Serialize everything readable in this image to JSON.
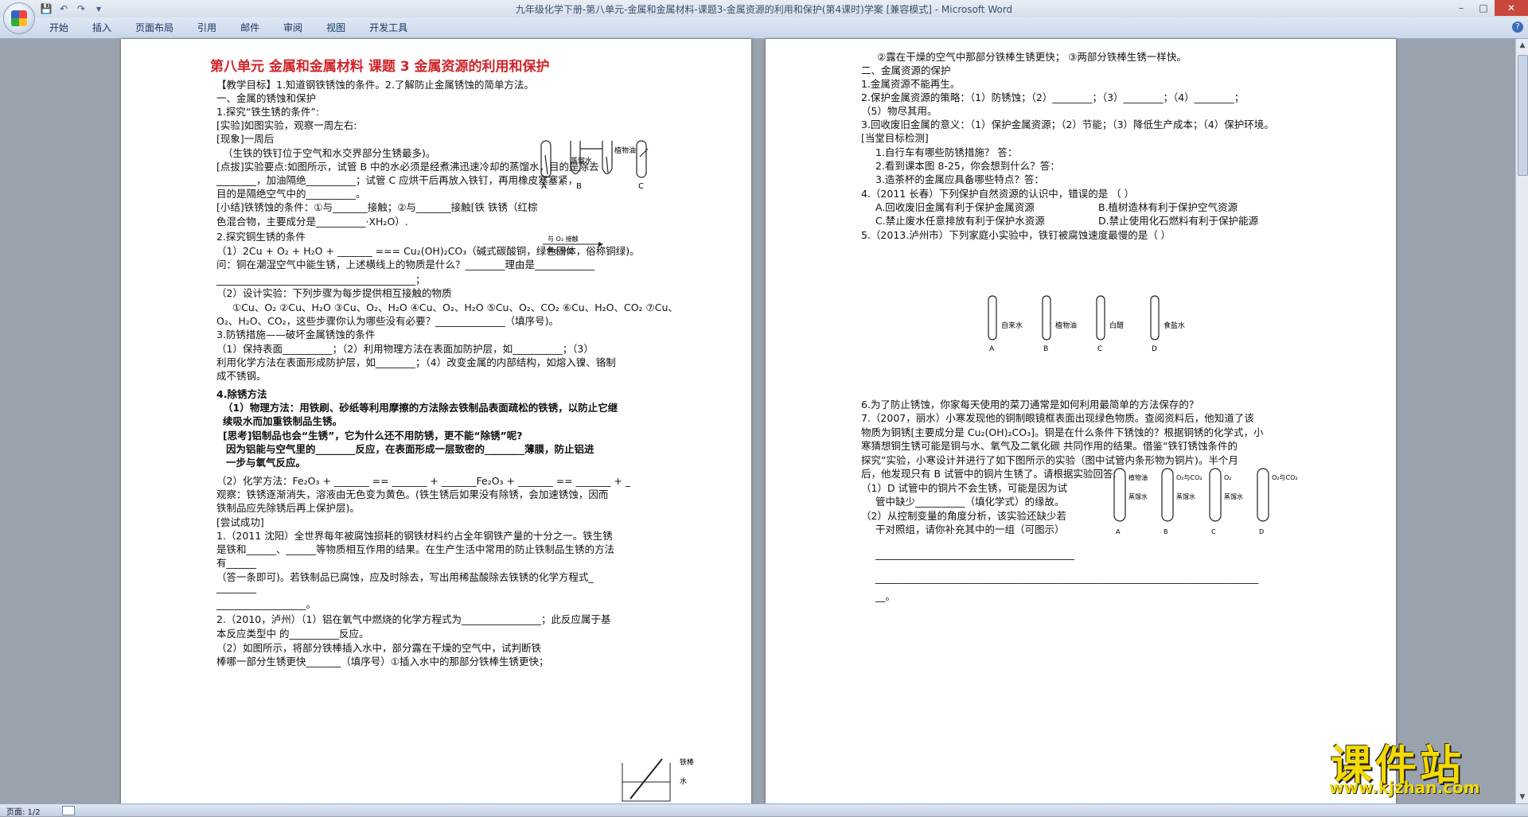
{
  "window": {
    "title": "九年级化学下册-第八单元-金属和金属材料-课题3-金属资源的利用和保护(第4课时)学案 [兼容模式] - Microsoft Word"
  },
  "ribbon": {
    "tabs": [
      "开始",
      "插入",
      "页面布局",
      "引用",
      "邮件",
      "审阅",
      "视图",
      "开发工具"
    ]
  },
  "status": {
    "page": "页面: 1/2"
  },
  "watermark": {
    "brand": "课件站",
    "url": "www.kjzhan.com"
  },
  "page1": {
    "title": "第八单元  金属和金属材料  课题 3  金属资源的利用和保护",
    "lines": [
      "【教学目标】1.知道钢铁锈蚀的条件。2.了解防止金属锈蚀的简单方法。",
      "一、金属的锈蚀和保护",
      "1.探究“铁生锈的条件”:",
      "[实验]如图实验，观察一周左右:",
      "[现象]一周后",
      "（生铁的铁钉位于空气和水交界部分生锈最多)。",
      "[点拔]实验要点:如图所示，试管 B 中的水必须是经煮沸迅速冷却的蒸馏水，目的是除去",
      "________，加油隔绝__________；试管 C 应烘干后再放入铁钉，再用橡皮塞塞紧，",
      "目的是隔绝空气中的__________。",
      "[小结]铁锈蚀的条件：①与_______接触；②与_______接触[铁            铁锈（红棕",
      "色混合物，主要成分是__________·XH₂O）.",
      "2.探究铜生锈的条件",
      "（1）2Cu + O₂ + H₂O + _______ === Cu₂(OH)₂CO₃（碱式碳酸铜，绿色固体，俗称铜绿)。",
      "问：铜在潮湿空气中能生锈，上述横线上的物质是什么？________理由是____________",
      "________________________________________；",
      "（2）设计实验：下列步骤为每步提供相互接触的物质",
      "①Cu、O₂ ②Cu、H₂O ③Cu、O₂、H₂O  ④Cu、O₂、H₂O  ⑤Cu、O₂、CO₂  ⑥Cu、H₂O、CO₂  ⑦Cu、",
      "O₂、H₂O、CO₂，这些步骤你认为哪些没有必要？______________（填序号)。",
      "3.防锈措施——破坏金属锈蚀的条件",
      "（1）保持表面__________；（2）利用物理方法在表面加防护层，如__________；（3）",
      "利用化学方法在表面形成防护层，如________；（4）改变金属的内部结构，如熔入镍、铬制",
      "成不锈钢。",
      "4.除锈方法",
      "（1）物理方法：用铁刷、砂纸等利用摩擦的方法除去铁制品表面疏松的铁锈，以防止它继",
      "续吸水而加重铁制品生锈。",
      "[思考]铝制品也会“生锈”，它为什么还不用防锈，更不能“除锈”呢?",
      "因为铝能与空气里的________反应，在表面形成一层致密的________薄膜，防止铝进",
      "一步与氧气反应。",
      "（2）化学方法：Fe₂O₃ + _______ == _______ + _______Fe₂O₃ + _______ == _______ + _",
      "观察：铁锈逐渐消失，溶液由无色变为黄色。(铁生锈后如果没有除锈，会加速锈蚀，因而",
      "铁制品应先除锈后再上保护层)。",
      "[尝试成功]",
      "1.（2011 沈阳）全世界每年被腐蚀损耗的钢铁材料约占全年钢铁产量的十分之一。铁生锈",
      "是铁和______、______等物质相互作用的结果。在生产生活中常用的防止铁制品生锈的方法",
      "有______",
      "（答一条即可)。若铁制品已腐蚀，应及时除去，写出用稀盐酸除去铁锈的化学方程式_",
      "________",
      "__________________。",
      "2.（2010，泸州）（1）铝在氧气中燃烧的化学方程式为________________；此反应属于基",
      "本反应类型中 的__________反应。",
      "（2）如图所示，将部分铁棒插入水中，部分露在干燥的空气中，试判断铁",
      "棒哪一部分生锈更快_______（填序号）①插入水中的那部分铁棒生锈更快；"
    ],
    "fig_labels": {
      "tube_labels": [
        "A",
        "B",
        "C"
      ],
      "water": "蒸馏水",
      "oil": "植物油",
      "arrow_top": "与 O₂ 接触",
      "arrow_bottom": "有水参加",
      "rod": "铁棒",
      "water2": "水"
    }
  },
  "page2": {
    "lines": [
      "②露在干燥的空气中那部分铁棒生锈更快；  ③两部分铁棒生锈一样快。",
      "二、金属资源的保护",
      "1.金属资源不能再生。",
      "2.保护金属资源的策略：（1）防锈蚀；（2）________；（3）________；（4）________；",
      "（5）物尽其用。",
      "3.回收废旧金属的意义：（1）保护金属资源；（2）节能；（3）降低生产成本；（4）保护环境。",
      "[当堂目标检测]",
      "1.自行车有哪些防锈措施？   答：",
      "2.看到课本图 8-25，你会想到什么？答：",
      "3.造茶杯的金属应具备哪些特点？答：",
      "4.（2011 长春）下列保护自然资源的认识中，错误的是   （      ）",
      "A.回收废旧金属有利于保护金属资源",
      "B.植树造林有利于保护空气资源",
      "C.禁止废水任意排放有利于保护水资源",
      "D.禁止使用化石燃料有利于保护能源",
      "5.（2013.泸州市）下列家庭小实验中，铁钉被腐蚀速度最慢的是（                  ）",
      "6.为了防止锈蚀，你家每天使用的菜刀通常是如何利用最简单的方法保存的？",
      "7.（2007，丽水）小寒发现他的铜制眼镜框表面出现绿色物质。查阅资料后，他知道了该",
      "物质为铜锈[主要成分是 Cu₂(OH)₂CO₃]。铜是在什么条件下锈蚀的？根据铜锈的化学式，小",
      "寒猜想铜生锈可能是铜与水、氧气及二氧化碳 共同作用的结果。借鉴“铁钉锈蚀条件的",
      "探究”实验，小寒设计并进行了如下图所示的实验（图中试管内条形物为铜片)。半个月",
      "后，他发现只有 B 试管中的铜片生锈了。请根据实验回答:",
      "（1）D 试管中的铜片不会生锈，可能是因为试",
      "管中缺少__________（填化学式）的缘故。",
      "（2）从控制变量的角度分析，该实验还缺少若",
      "干对照组，请你补充其中的一组（可图示）",
      "________________________________________",
      "_____________________________________________________________________________",
      "__。"
    ],
    "fig5_labels": [
      "自来水",
      "植物油",
      "白醋",
      "食盐水"
    ],
    "fig5_tubes": [
      "A",
      "B",
      "C",
      "D"
    ],
    "fig7_labels": [
      "植物油",
      "O₂与CO₂",
      "O₂",
      "O₂与CO₂",
      "蒸馏水",
      "蒸馏水",
      "蒸馏水"
    ],
    "fig7_tubes": [
      "A",
      "B",
      "C",
      "D"
    ]
  }
}
